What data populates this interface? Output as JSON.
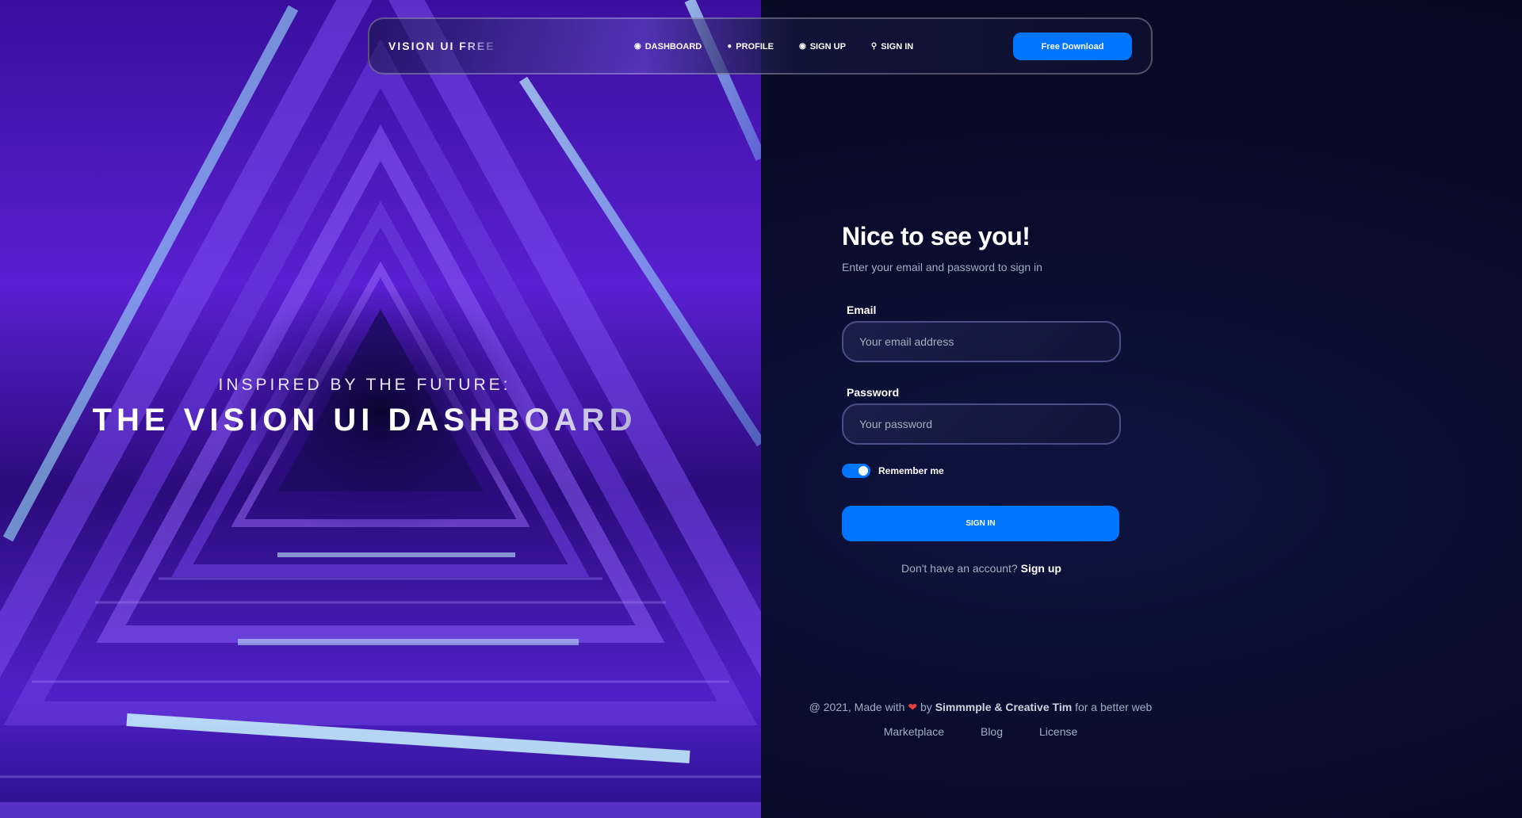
{
  "navbar": {
    "brand": "VISION UI FREE",
    "links": [
      {
        "label": "DASHBOARD",
        "icon": "dashboard-icon"
      },
      {
        "label": "PROFILE",
        "icon": "person-icon"
      },
      {
        "label": "SIGN UP",
        "icon": "user-circle-icon"
      },
      {
        "label": "SIGN IN",
        "icon": "key-icon"
      }
    ],
    "download_label": "Free Download"
  },
  "hero": {
    "subtitle": "INSPIRED BY THE FUTURE:",
    "title": "THE VISION UI DASHBOARD"
  },
  "signin": {
    "title": "Nice to see you!",
    "subtitle": "Enter your email and password to sign in",
    "email_label": "Email",
    "email_placeholder": "Your email address",
    "password_label": "Password",
    "password_placeholder": "Your password",
    "remember_label": "Remember me",
    "remember_checked": true,
    "button_label": "SIGN IN",
    "no_account_text": "Don't have an account?",
    "signup_link": "Sign up"
  },
  "footer": {
    "prefix": "@ 2021, Made with",
    "by": "by",
    "authors": "Simmmple & Creative Tim",
    "suffix": "for a better web",
    "links": [
      "Marketplace",
      "Blog",
      "License"
    ]
  },
  "colors": {
    "accent": "#0075ff",
    "background": "#090b2a",
    "muted_text": "#a0aec0",
    "hero_purple": "#5a1fd1"
  }
}
